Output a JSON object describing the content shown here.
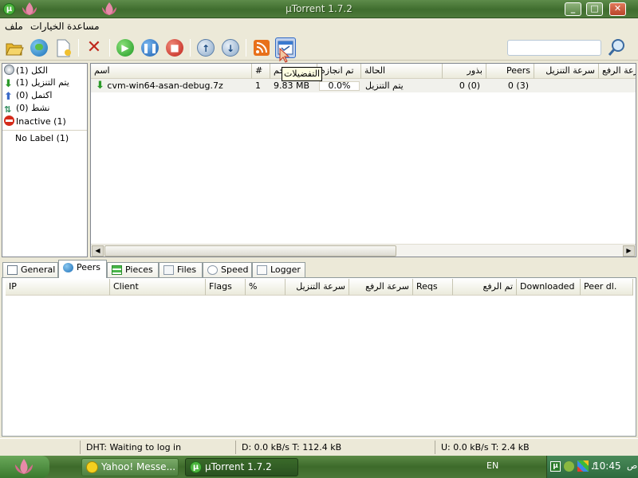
{
  "window": {
    "title": "µTorrent 1.7.2",
    "app_icon_glyph": "µ"
  },
  "menu": {
    "file": "ملف",
    "options": "الخيارات",
    "help": "مساعدة"
  },
  "toolbar": {
    "buttons": [
      "add-torrent",
      "add-torrent-url",
      "create-torrent",
      "remove",
      "start",
      "pause",
      "stop",
      "move-up",
      "move-down",
      "rss",
      "preferences"
    ],
    "tooltip": "التفضيلات",
    "search_placeholder": ""
  },
  "sidebar": {
    "items": [
      {
        "label": "الكل (1)",
        "icon": "all-icon"
      },
      {
        "label": "يتم التنزيل (1)",
        "icon": "downloading-icon"
      },
      {
        "label": "اكتمل (0)",
        "icon": "completed-icon"
      },
      {
        "label": "نشط (0)",
        "icon": "active-icon"
      },
      {
        "label": "Inactive (1)",
        "icon": "inactive-icon"
      }
    ],
    "no_label": "No Label (1)"
  },
  "torrent_list": {
    "columns": [
      "اسم",
      "#",
      "حجم",
      "تم انجازه",
      "الحالة",
      "بذور",
      "Peers",
      "سرعة التنزيل",
      "سرعة الرفع"
    ],
    "rows": [
      {
        "name": "cvm-win64-asan-debug.7z",
        "num": "1",
        "size": "9.83 MB",
        "done": "0.0%",
        "status": "يتم التنزيل",
        "seeds": "0 (0)",
        "peers": "0 (3)",
        "down": "",
        "up": ""
      }
    ]
  },
  "tabs": [
    "General",
    "Peers",
    "Pieces",
    "Files",
    "Speed",
    "Logger"
  ],
  "active_tab": "Peers",
  "peers_table": {
    "columns": [
      "IP",
      "Client",
      "Flags",
      "%",
      "سرعة التنزيل",
      "سرعة الرفع",
      "Reqs",
      "تم الرفع",
      "Downloaded",
      "Peer dl."
    ]
  },
  "status_bar": {
    "dht": "DHT: Waiting to log in",
    "down": "D: 0.0 kB/s T: 112.4 kB",
    "up": "U: 0.0 kB/s T: 2.4 kB"
  },
  "taskbar": {
    "tasks": [
      {
        "label": "Yahoo! Messe..."
      },
      {
        "label": "µTorrent 1.7.2"
      }
    ],
    "lang": "EN",
    "clock": "10:45",
    "ampm": "ص"
  },
  "colors": {
    "accent_green": "#4bb53d",
    "xp_face": "#ece9d8",
    "taskbar_green": "#4a7a36"
  }
}
